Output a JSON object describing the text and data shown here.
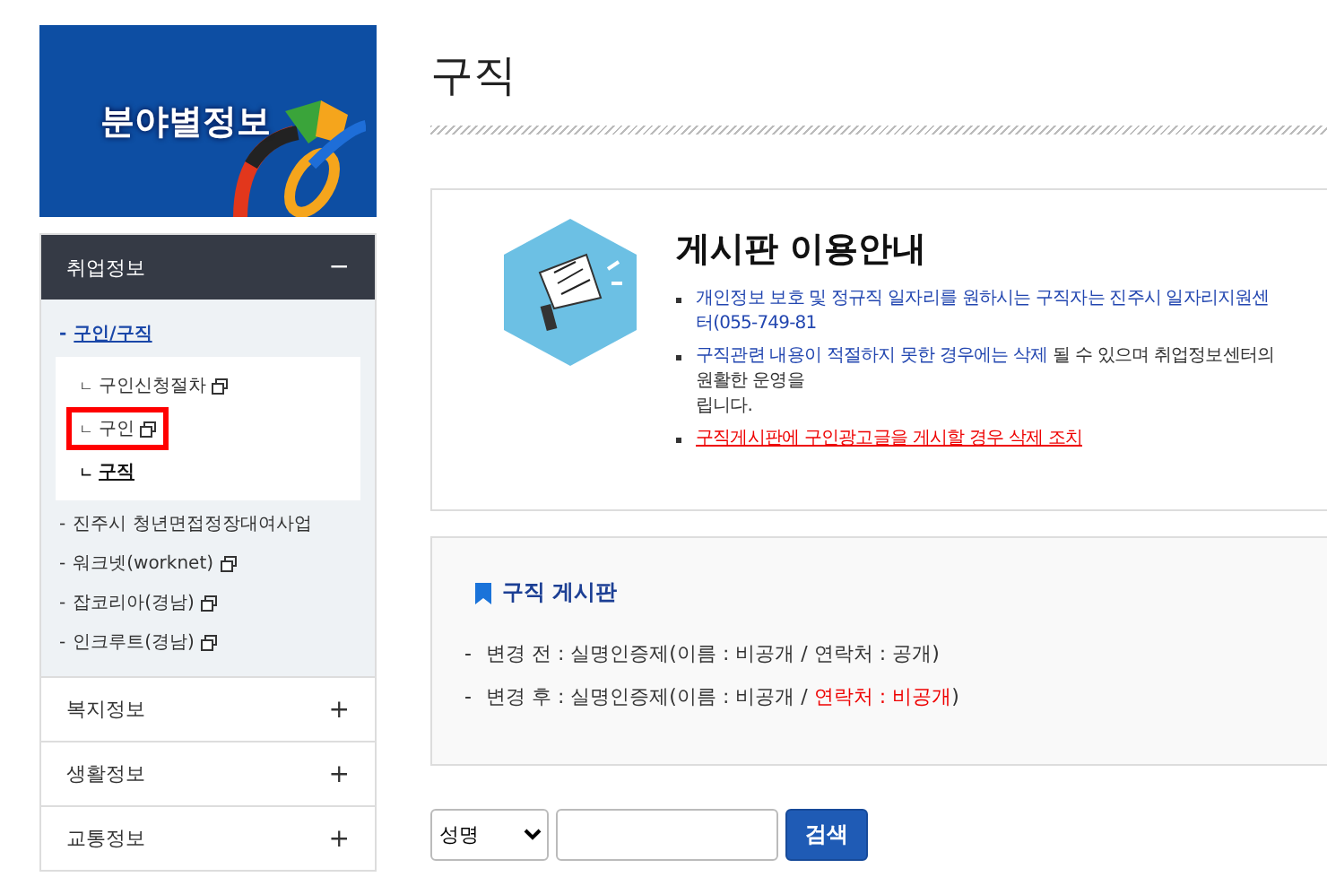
{
  "sidebar": {
    "banner": {
      "title": "분야별정보"
    },
    "sections": [
      {
        "label": "취업정보",
        "expanded": true,
        "toggle": "−",
        "items": [
          {
            "bullet": "-",
            "label": "구인/구직",
            "selected": true,
            "external": false,
            "children": [
              {
                "marker": "ㄴ",
                "label": "구인신청절차",
                "selected": false,
                "external": true,
                "highlighted": false
              },
              {
                "marker": "ㄴ",
                "label": "구인",
                "selected": false,
                "external": true,
                "highlighted": true
              },
              {
                "marker": "ㄴ",
                "label": "구직",
                "selected": true,
                "external": false,
                "highlighted": false
              }
            ]
          },
          {
            "bullet": "-",
            "label": "진주시 청년면접정장대여사업",
            "selected": false,
            "external": false
          },
          {
            "bullet": "-",
            "label": "워크넷(worknet)",
            "selected": false,
            "external": true
          },
          {
            "bullet": "-",
            "label": "잡코리아(경남)",
            "selected": false,
            "external": true
          },
          {
            "bullet": "-",
            "label": "인크루트(경남)",
            "selected": false,
            "external": true
          }
        ]
      },
      {
        "label": "복지정보",
        "expanded": false,
        "toggle": "+"
      },
      {
        "label": "생활정보",
        "expanded": false,
        "toggle": "+"
      },
      {
        "label": "교통정보",
        "expanded": false,
        "toggle": "+"
      }
    ]
  },
  "page_title": "구직",
  "notice": {
    "title": "게시판 이용안내",
    "bullets": [
      {
        "lines": [
          [
            {
              "kind": "link",
              "text": "개인정보 보호 및 정규직 일자리를 원하시는 구직자는 진주시 일자리지원센터(055-749-81"
            }
          ]
        ]
      },
      {
        "lines": [
          [
            {
              "kind": "link",
              "text": "구직관련 내용이 적절하지 못한 경우에는 삭제"
            },
            {
              "kind": "plain",
              "text": " 될 수 있으며 취업정보센터의 원활한 운영을"
            }
          ],
          [
            {
              "kind": "plain",
              "text": "립니다."
            }
          ]
        ]
      },
      {
        "lines": [
          [
            {
              "kind": "warning",
              "text": "구직게시판에 구인광고글을 게시할 경우 삭제 조치"
            }
          ]
        ]
      }
    ]
  },
  "board_info": {
    "title": "구직 게시판",
    "rows": [
      {
        "dash": "-",
        "segments": [
          {
            "kind": "plain",
            "text": "변경 전 : 실명인증제(이름 : 비공개 / 연락처 : 공개)"
          }
        ]
      },
      {
        "dash": "-",
        "segments": [
          {
            "kind": "plain",
            "text": "변경 후 : 실명인증제(이름 : 비공개 / "
          },
          {
            "kind": "alert",
            "text": "연락처 : 비공개"
          },
          {
            "kind": "plain",
            "text": ")"
          }
        ]
      }
    ]
  },
  "search": {
    "field_select": "성명",
    "button": "검색"
  }
}
